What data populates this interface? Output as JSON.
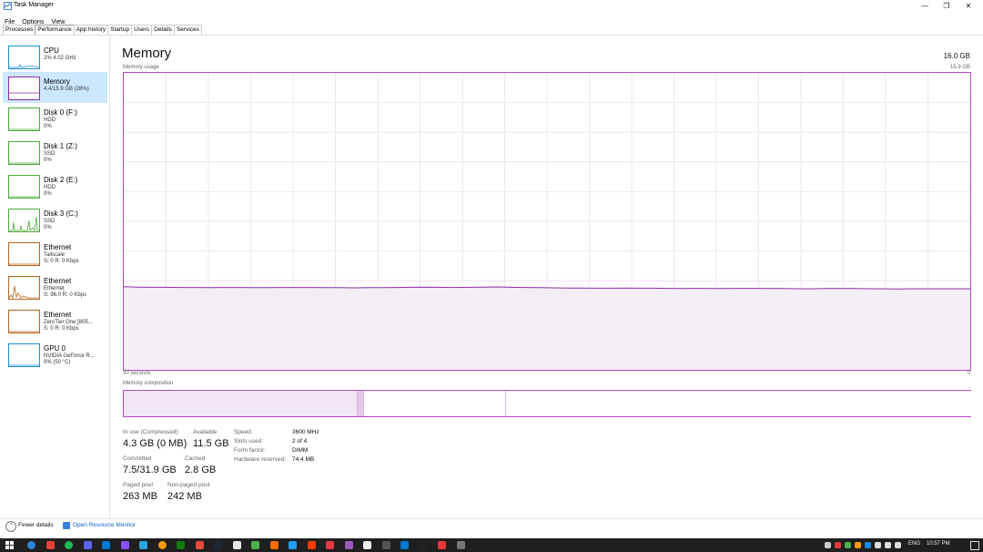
{
  "window": {
    "title": "Task Manager",
    "controls": [
      "—",
      "❐",
      "✕"
    ]
  },
  "menu": [
    "File",
    "Options",
    "View"
  ],
  "tabs": [
    {
      "label": "Processes",
      "active": false
    },
    {
      "label": "Performance",
      "active": true
    },
    {
      "label": "App history",
      "active": false
    },
    {
      "label": "Startup",
      "active": false
    },
    {
      "label": "Users",
      "active": false
    },
    {
      "label": "Details",
      "active": false
    },
    {
      "label": "Services",
      "active": false
    }
  ],
  "sidebar": [
    {
      "name": "CPU",
      "sub": "2% 4.02 GHz",
      "sub2": "",
      "color": "#1a8ed6",
      "selected": false
    },
    {
      "name": "Memory",
      "sub": "4.4/15.9 GB (28%)",
      "sub2": "",
      "color": "#8b2ea3",
      "selected": true
    },
    {
      "name": "Disk 0 (F:)",
      "sub": "HDD",
      "sub2": "0%",
      "color": "#4ca83a",
      "selected": false
    },
    {
      "name": "Disk 1 (Z:)",
      "sub": "SSD",
      "sub2": "0%",
      "color": "#4ca83a",
      "selected": false
    },
    {
      "name": "Disk 2 (E:)",
      "sub": "HDD",
      "sub2": "0%",
      "color": "#4ca83a",
      "selected": false
    },
    {
      "name": "Disk 3 (C:)",
      "sub": "SSD",
      "sub2": "0%",
      "color": "#4ca83a",
      "selected": false
    },
    {
      "name": "Ethernet",
      "sub": "Tailscale",
      "sub2": "S: 0 R: 0 Kbps",
      "color": "#b5651d",
      "selected": false
    },
    {
      "name": "Ethernet",
      "sub": "Ethernet",
      "sub2": "S: 96.0 R: 0 Kbps",
      "color": "#b5651d",
      "selected": false
    },
    {
      "name": "Ethernet",
      "sub": "ZeroTier One [805...",
      "sub2": "S: 0 R: 0 Kbps",
      "color": "#b5651d",
      "selected": false
    },
    {
      "name": "GPU 0",
      "sub": "NVIDIA GeForce R...",
      "sub2": "0% (50 °C)",
      "color": "#1a8ed6",
      "selected": false
    }
  ],
  "main": {
    "title": "Memory",
    "total": "16.0 GB",
    "usage_label": "Memory usage",
    "usage_max": "15.9 GB",
    "axis_left": "30 seconds",
    "axis_right": "0",
    "composition_label": "Memory composition"
  },
  "chart_data": {
    "type": "area",
    "title": "Memory usage",
    "ylim": [
      0,
      15.9
    ],
    "x_range_seconds": [
      30,
      0
    ],
    "grid": true,
    "color": "#8b2ea3",
    "fill": "#f3eef6",
    "values": [
      4.45,
      4.43,
      4.42,
      4.42,
      4.41,
      4.41,
      4.4,
      4.41,
      4.41,
      4.4,
      4.4,
      4.41,
      4.41,
      4.41,
      4.4,
      4.4,
      4.39,
      4.4,
      4.4,
      4.41,
      4.42,
      4.43,
      4.42,
      4.41,
      4.42,
      4.43,
      4.44,
      4.42,
      4.41,
      4.4,
      4.39,
      4.38,
      4.38,
      4.37,
      4.37,
      4.38,
      4.37,
      4.37,
      4.36,
      4.35,
      4.36,
      4.35,
      4.35,
      4.36,
      4.36,
      4.35,
      4.35,
      4.34,
      4.34,
      4.35,
      4.35,
      4.35,
      4.34,
      4.34,
      4.33,
      4.34,
      4.34,
      4.34,
      4.34,
      4.34
    ]
  },
  "composition": [
    {
      "label": "In use",
      "fraction": 0.275,
      "color": "#f1e6f3"
    },
    {
      "label": "Modified",
      "fraction": 0.008,
      "color": "#e2c8e8"
    },
    {
      "label": "Standby",
      "fraction": 0.167,
      "color": "#ffffff"
    },
    {
      "label": "Free",
      "fraction": 0.55,
      "color": "#ffffff"
    }
  ],
  "stats": [
    {
      "label": "In use (Compressed)",
      "value": "4.3 GB (0 MB)"
    },
    {
      "label": "Available",
      "value": "11.5 GB"
    },
    {
      "label": "Committed",
      "value": "7.5/31.9 GB"
    },
    {
      "label": "Cached",
      "value": "2.8 GB"
    },
    {
      "label": "Paged pool",
      "value": "263 MB"
    },
    {
      "label": "Non-paged pool",
      "value": "242 MB"
    }
  ],
  "specs": [
    {
      "label": "Speed:",
      "value": "3600 MHz"
    },
    {
      "label": "Slots used:",
      "value": "2 of 4"
    },
    {
      "label": "Form factor:",
      "value": "DIMM"
    },
    {
      "label": "Hardware reserved:",
      "value": "74.4 MB"
    }
  ],
  "footer": {
    "fewer_details": "Fewer details",
    "open_monitor": "Open Resource Monitor"
  },
  "taskbar": {
    "language": "ENG",
    "time": "10:57 PM",
    "icons": [
      "#2b86d8",
      "#e94235",
      "#1db954",
      "#5865f2",
      "#0078d4",
      "#8a4fff",
      "#2ca5e0",
      "#f39c12",
      "#107c10",
      "#e74c3c",
      "#1b2838",
      "#e6e6e6",
      "#4caf50",
      "#ff6d00",
      "#1da1f2",
      "#ff3d00",
      "#e63946",
      "#9b59b6",
      "#eeeeee",
      "#555555",
      "#007acc",
      "#222222",
      "#e53935",
      "#777777"
    ]
  }
}
